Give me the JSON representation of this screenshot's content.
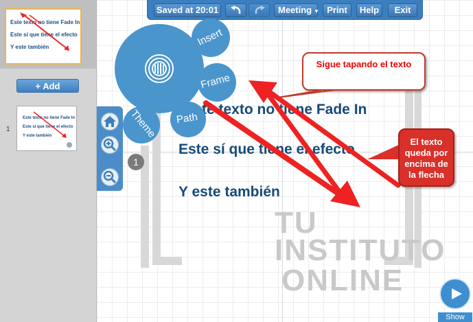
{
  "toolbar": {
    "saved": "Saved at 20:01",
    "meeting": "Meeting",
    "print": "Print",
    "help": "Help",
    "exit": "Exit"
  },
  "sidebar": {
    "add_label": "+ Add",
    "slide_number": "1",
    "thumb_lines": [
      "Este texto no tiene Fade In",
      "Este sí que tiene el efecto",
      "Y este también"
    ]
  },
  "menu": {
    "insert": "Insert",
    "frame": "Frame",
    "path": "Path",
    "theme": "Theme"
  },
  "badge": "1",
  "slide": {
    "line1": "te texto no tiene Fade In",
    "line2": "Este sí que tiene el efecto",
    "line3": "Y este también"
  },
  "callouts": {
    "top": "Sigue tapando el texto",
    "right": "El texto queda por encima de la flecha"
  },
  "watermark": {
    "line1": "TU",
    "line2": "INSTITUTO",
    "line3": "ONLINE"
  },
  "show": "Show",
  "colors": {
    "toolbar": "#3b7fc0",
    "circle": "#4a95cc",
    "slide_text": "#164a79",
    "arrow": "#ee2222"
  }
}
